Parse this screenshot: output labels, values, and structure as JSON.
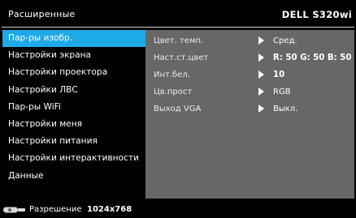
{
  "header": {
    "title": "Расширенные",
    "model": "DELL S320wi"
  },
  "sidebar": {
    "items": [
      {
        "label": "Пар-ры изобр.",
        "active": true
      },
      {
        "label": "Настройки экрана",
        "active": false
      },
      {
        "label": "Настройки проектора",
        "active": false
      },
      {
        "label": "Настройки ЛВС",
        "active": false
      },
      {
        "label": "Пар-ры WiFi",
        "active": false
      },
      {
        "label": "Настройки меня",
        "active": false
      },
      {
        "label": "Настройки питания",
        "active": false
      },
      {
        "label": "Настройки интерактивности",
        "active": false
      },
      {
        "label": "Данные",
        "active": false
      }
    ]
  },
  "panel": {
    "rows": [
      {
        "label": "Цвет. темп.",
        "value": "Сред."
      },
      {
        "label": "Наст.ст.цвет",
        "value": "R: 50 G: 50 B: 50"
      },
      {
        "label": "Инт.бел.",
        "value": "10"
      },
      {
        "label": "Цв.прост",
        "value": "RGB"
      },
      {
        "label": "Выход VGA",
        "value": "Выкл."
      }
    ]
  },
  "status": {
    "icon": "projector-input-icon",
    "label": "Разрешение",
    "value": "1024x768"
  },
  "colors": {
    "accent": "#1ea9e8",
    "panel": "#676767",
    "background": "#000000"
  }
}
